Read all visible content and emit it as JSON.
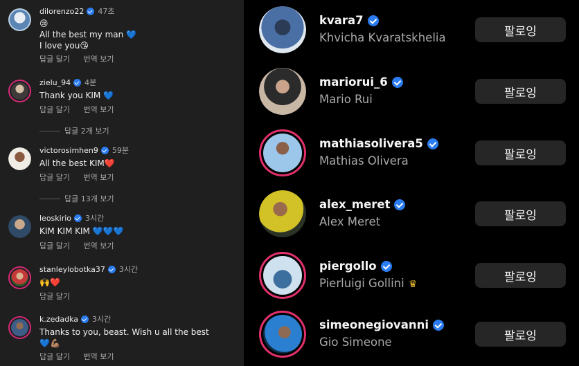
{
  "comments": [
    {
      "username": "dilorenzo22",
      "time": "47초",
      "text": "😢\nAll the best my man 💙\nI love you😘",
      "actions": [
        "답글 달기",
        "번역 보기"
      ]
    },
    {
      "username": "zielu_94",
      "time": "4분",
      "text": "Thank you KIM 💙",
      "actions": [
        "답글 달기",
        "번역 보기"
      ],
      "replies": "답글 2개 보기"
    },
    {
      "username": "victorosimhen9",
      "time": "59분",
      "text": "All the best KIM❤️",
      "actions": [
        "답글 달기",
        "번역 보기"
      ],
      "replies": "답글 13개 보기"
    },
    {
      "username": "leoskirio",
      "time": "3시간",
      "text": "KIM KIM KIM 💙💙💙",
      "actions": [
        "답글 달기",
        "번역 보기"
      ]
    },
    {
      "username": "stanleylobotka37",
      "time": "3시간",
      "text": "🙌❤️",
      "actions": [
        "답글 달기"
      ]
    },
    {
      "username": "k.zedadka",
      "time": "3시간",
      "text": "Thanks to you, beast. Wish u all the best\n💙💪🏽",
      "actions": [
        "답글 달기",
        "번역 보기"
      ]
    }
  ],
  "following": [
    {
      "username": "kvara7",
      "name": "Khvicha Kvaratskhelia",
      "button": "팔로잉",
      "avatar_colors": [
        "#4a6fa5",
        "#dfe7ef"
      ]
    },
    {
      "username": "mariorui_6",
      "name": "Mario Rui",
      "button": "팔로잉",
      "avatar_colors": [
        "#7a5a48",
        "#c9b7a6"
      ]
    },
    {
      "username": "mathiasolivera5",
      "name": "Mathias Olivera",
      "button": "팔로잉",
      "avatar_colors": [
        "#4c8ec7",
        "#9cc6ea"
      ]
    },
    {
      "username": "alex_meret",
      "name": "Alex Meret",
      "button": "팔로잉",
      "avatar_colors": [
        "#d3c227",
        "#2b3326"
      ]
    },
    {
      "username": "piergollo",
      "name": "Pierluigi Gollini",
      "button": "팔로잉",
      "avatar_colors": [
        "#4f86c0",
        "#cfe0ee"
      ]
    },
    {
      "username": "simeonegiovanni",
      "name": "Gio Simeone",
      "button": "팔로잉",
      "avatar_colors": [
        "#2a7fd0",
        "#0f2a44"
      ]
    }
  ],
  "colors": {
    "left_bg": "#1f1f1f",
    "right_bg": "#000000",
    "verified": "#2b7cf0",
    "button_bg": "#262626",
    "secondary_text": "#a8a8a8",
    "story_ring": "#e1306c"
  }
}
